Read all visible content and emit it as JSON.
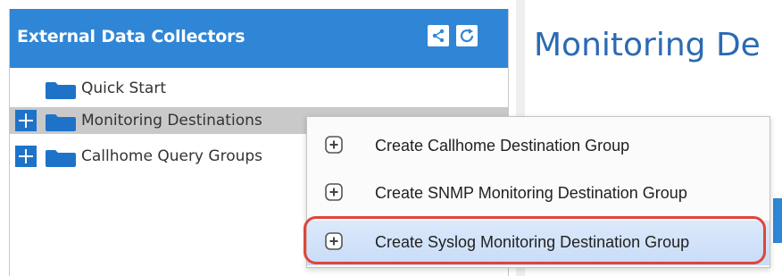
{
  "panel": {
    "title": "External Data Collectors",
    "header_color": "#2f86d6",
    "buttons": [
      {
        "name": "share-icon"
      },
      {
        "name": "refresh-icon"
      }
    ]
  },
  "tree": {
    "items": [
      {
        "label": "Quick Start",
        "expandable": false,
        "selected": false
      },
      {
        "label": "Monitoring Destinations",
        "expandable": true,
        "selected": true
      },
      {
        "label": "Callhome Query Groups",
        "expandable": true,
        "selected": false
      }
    ]
  },
  "main": {
    "title": "Monitoring De"
  },
  "context_menu": {
    "items": [
      {
        "label": "Create Callhome Destination Group",
        "icon": "plus-circle-icon"
      },
      {
        "label": "Create SNMP Monitoring Destination Group",
        "icon": "plus-circle-icon"
      },
      {
        "label": "Create Syslog Monitoring Destination Group",
        "icon": "plus-circle-icon",
        "highlighted": true
      }
    ],
    "annotation_color": "#e0453a"
  }
}
